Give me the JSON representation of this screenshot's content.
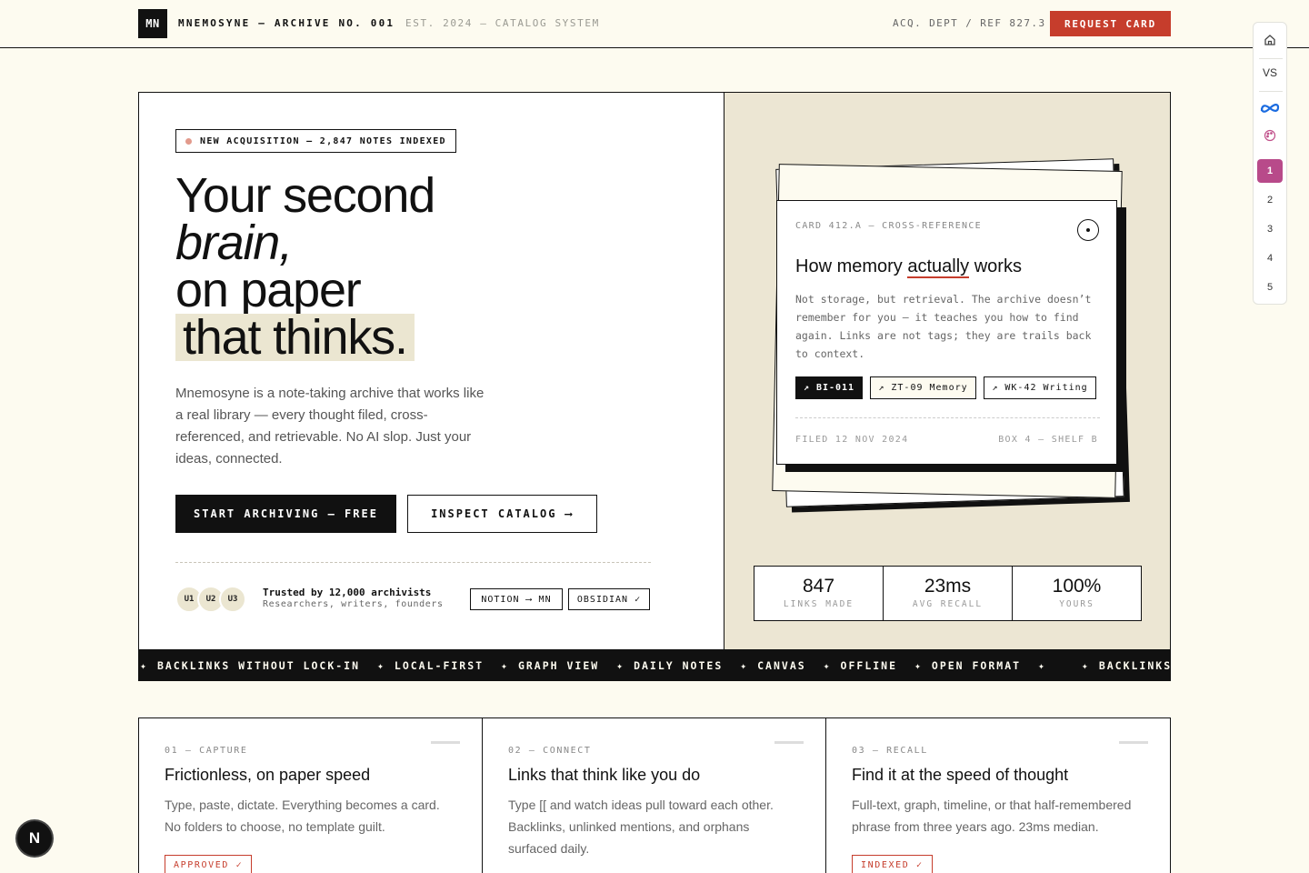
{
  "topbar": {
    "logo": "MN",
    "brand": "MNEMOSYNE — ARCHIVE NO. 001",
    "established": "EST. 2024 — CATALOG SYSTEM",
    "reference": "ACQ. DEPT / REF 827.3",
    "cta": "REQUEST CARD"
  },
  "rail": {
    "items": [
      {
        "icon": "home-icon"
      },
      {
        "label": "VS"
      },
      {
        "icon": "meta-icon"
      },
      {
        "icon": "palette-icon"
      }
    ],
    "pages": [
      "1",
      "2",
      "3",
      "4",
      "5"
    ],
    "active_page": "1"
  },
  "hero": {
    "badge": "NEW ACQUISITION — 2,847 NOTES INDEXED",
    "headline": {
      "line1": "Your second",
      "line2": "brain,",
      "line3": "on paper",
      "line4": "that thinks."
    },
    "description": "Mnemosyne is a note-taking archive that works like a real library — every thought filed, cross-referenced, and retrievable. No AI slop. Just your ideas, connected.",
    "primary_cta": "START ARCHIVING — FREE",
    "secondary_cta": "INSPECT CATALOG ⟶",
    "avatars": [
      "U1",
      "U2",
      "U3"
    ],
    "trust_title": "Trusted by 12,000 archivists",
    "trust_subtitle": "Researchers, writers, founders",
    "integrations": [
      "NOTION ⟶ MN",
      "OBSIDIAN ✓"
    ]
  },
  "card": {
    "code": "CARD 412.A — CROSS-REFERENCE",
    "title_pre": "How memory ",
    "title_underlined": "actually",
    "title_post": " works",
    "body": "Not storage, but retrieval. The archive doesn’t remember for you — it teaches you how to find again. Links are not tags; they are trails back to context.",
    "tags": [
      "↗ BI-011",
      "↗ ZT-09 Memory",
      "↗ WK-42 Writing"
    ],
    "filed": "FILED 12 NOV 2024",
    "location": "BOX 4 — SHELF B"
  },
  "stats": [
    {
      "value": "847",
      "label": "LINKS MADE"
    },
    {
      "value": "23ms",
      "label": "AVG RECALL"
    },
    {
      "value": "100%",
      "label": "YOURS"
    }
  ],
  "ticker": [
    "BACKLINKS WITHOUT LOCK-IN",
    "LOCAL-FIRST",
    "GRAPH VIEW",
    "DAILY NOTES",
    "CANVAS",
    "OFFLINE",
    "OPEN FORMAT",
    "BACKLINKS WITHOUT LOCK-IN"
  ],
  "features": [
    {
      "num": "01 — CAPTURE",
      "title": "Frictionless, on paper speed",
      "desc": "Type, paste, dictate. Everything becomes a card. No folders to choose, no template guilt.",
      "badge": "APPROVED ✓"
    },
    {
      "num": "02 — CONNECT",
      "title": "Links that think like you do",
      "desc": "Type [[ and watch ideas pull toward each other. Backlinks, unlinked mentions, and orphans surfaced daily.",
      "badge": ""
    },
    {
      "num": "03 — RECALL",
      "title": "Find it at the speed of thought",
      "desc": "Full-text, graph, timeline, or that half-remembered phrase from three years ago. 23ms median.",
      "badge": "INDEXED ✓"
    }
  ],
  "dev_badge": "N",
  "colors": {
    "accent": "#c63d2c",
    "cream": "#fdfbf0",
    "panel": "#ece6d3",
    "ink": "#111111",
    "rail_active": "#b84a8a"
  }
}
